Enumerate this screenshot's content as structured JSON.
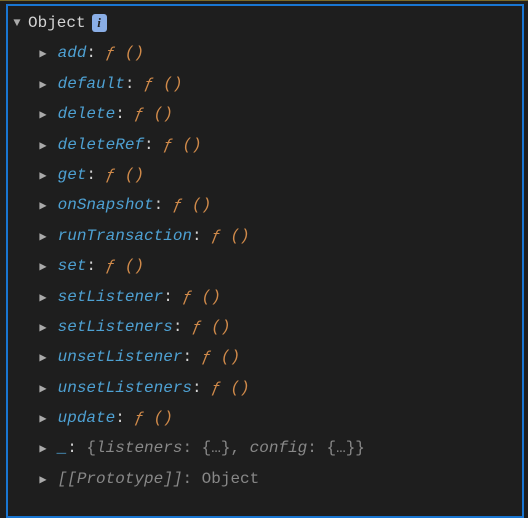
{
  "root": {
    "label": "Object",
    "info": "i"
  },
  "items": [
    {
      "key": "add",
      "val": "ƒ ()",
      "kind": "fn"
    },
    {
      "key": "default",
      "val": "ƒ ()",
      "kind": "fn"
    },
    {
      "key": "delete",
      "val": "ƒ ()",
      "kind": "fn"
    },
    {
      "key": "deleteRef",
      "val": "ƒ ()",
      "kind": "fn"
    },
    {
      "key": "get",
      "val": "ƒ ()",
      "kind": "fn"
    },
    {
      "key": "onSnapshot",
      "val": "ƒ ()",
      "kind": "fn"
    },
    {
      "key": "runTransaction",
      "val": "ƒ ()",
      "kind": "fn"
    },
    {
      "key": "set",
      "val": "ƒ ()",
      "kind": "fn"
    },
    {
      "key": "setListener",
      "val": "ƒ ()",
      "kind": "fn"
    },
    {
      "key": "setListeners",
      "val": "ƒ ()",
      "kind": "fn"
    },
    {
      "key": "unsetListener",
      "val": "ƒ ()",
      "kind": "fn"
    },
    {
      "key": "unsetListeners",
      "val": "ƒ ()",
      "kind": "fn"
    },
    {
      "key": "update",
      "val": "ƒ ()",
      "kind": "fn"
    }
  ],
  "underscore": {
    "key": "_",
    "preview_open": "{",
    "preview_close": "}",
    "inner": [
      {
        "k": "listeners",
        "v": "{…}"
      },
      {
        "k": "config",
        "v": "{…}"
      }
    ]
  },
  "prototype": {
    "key": "[[Prototype]]",
    "val": "Object"
  },
  "glyphs": {
    "expanded": "▼",
    "collapsed": "▶",
    "colon": ":"
  }
}
